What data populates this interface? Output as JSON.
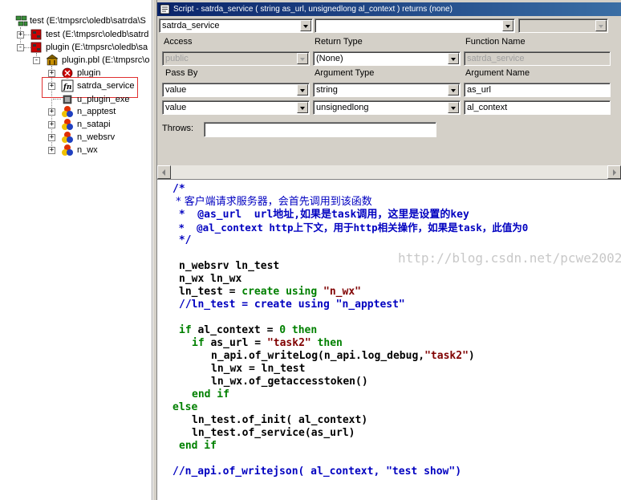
{
  "tree": {
    "nodes": [
      {
        "label": "test (E:\\tmpsrc\\oledb\\satrda\\S",
        "expander": ""
      },
      {
        "label": "test (E:\\tmpsrc\\oledb\\satrd",
        "expander": "+"
      },
      {
        "label": "plugin (E:\\tmpsrc\\oledb\\sa",
        "expander": "-"
      },
      {
        "label": "plugin.pbl (E:\\tmpsrc\\o",
        "expander": "-"
      },
      {
        "label": "plugin",
        "expander": "+"
      },
      {
        "label": "satrda_service",
        "expander": "+"
      },
      {
        "label": "u_plugin_exe",
        "expander": ""
      },
      {
        "label": "n_apptest",
        "expander": "+"
      },
      {
        "label": "n_satapi",
        "expander": "+"
      },
      {
        "label": "n_websrv",
        "expander": "+"
      },
      {
        "label": "n_wx",
        "expander": "+"
      }
    ]
  },
  "script": {
    "title": "Script - satrda_service ( string as_url, unsignedlong al_context ) returns (none)",
    "object_combo": "satrda_service",
    "event_combo": "",
    "ancestor_combo": "",
    "labels": {
      "access": "Access",
      "return_type": "Return Type",
      "function_name": "Function Name",
      "pass_by": "Pass By",
      "argument_type": "Argument Type",
      "argument_name": "Argument Name",
      "throws": "Throws:"
    },
    "access": "public",
    "return_type": "(None)",
    "function_name": "satrda_service",
    "args": [
      {
        "pass_by": "value",
        "type": "string",
        "name": "as_url"
      },
      {
        "pass_by": "value",
        "type": "unsignedlong",
        "name": "al_context"
      }
    ],
    "throws": ""
  },
  "code": {
    "c1": "/*",
    "c2": " * 客户端请求服务器，会首先调用到该函数",
    "c3": " *  @as_url  url地址,如果是task调用，这里是设置的key",
    "c4": " *  @al_context http上下文，用于http相关操作，如果是task，此值为0",
    "c5": " */",
    "d1": "n_websrv ln_test",
    "d2": "n_wx ln_wx",
    "a1_lhs": "ln_test = ",
    "a1_kw": "create using ",
    "a1_str": "\"n_wx\"",
    "a2": "//ln_test = create using \"n_apptest\"",
    "if_kw": "if",
    "if_rest": " al_context = ",
    "zero": "0",
    "then_kw": " then",
    "if2_kw": "if",
    "if2_mid": " as_url = ",
    "if2_str": "\"task2\"",
    "then2_kw": " then",
    "log_a": "n_api.of_writeLog(n_api.log_debug,",
    "log_str": "\"task2\"",
    "log_b": ")",
    "assign": "ln_wx = ln_test",
    "token": "ln_wx.of_getaccesstoken()",
    "endif1": "end if",
    "else": "else",
    "init": "ln_test.of_init( al_context)",
    "service": "ln_test.of_service(as_url)",
    "endif2": "end if",
    "last": "//n_api.of_writejson( al_context, \"test show\")"
  },
  "watermark": "http://blog.csdn.net/pcwe2002"
}
